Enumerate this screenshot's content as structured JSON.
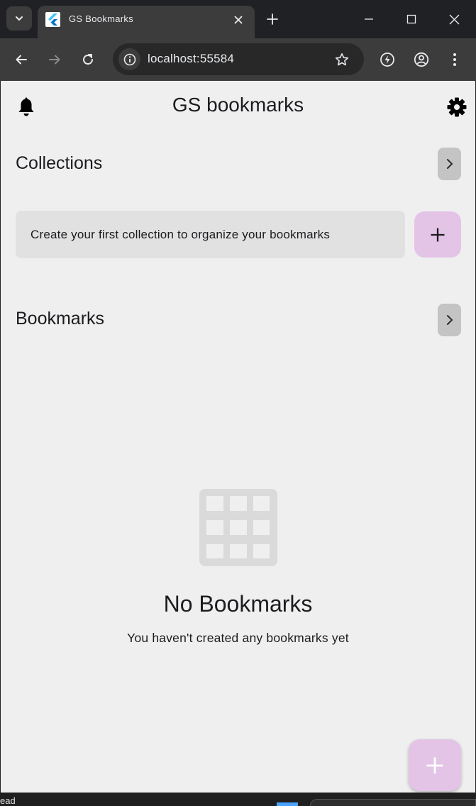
{
  "browser": {
    "tab_title": "GS Bookmarks",
    "url": "localhost:55584",
    "icons": {
      "tab_search": "chevron-down-icon",
      "favicon": "flutter-icon",
      "tab_close": "close-icon",
      "new_tab": "plus-icon",
      "minimize": "minimize-icon",
      "maximize": "maximize-icon",
      "close_window": "close-icon",
      "back": "arrow-left-icon",
      "forward": "arrow-right-icon",
      "reload": "reload-icon",
      "site_info": "info-icon",
      "bookmark_star": "star-icon",
      "performance": "lightning-icon",
      "profile": "profile-icon",
      "menu": "kebab-icon"
    }
  },
  "app": {
    "title": "GS bookmarks",
    "icons": {
      "notifications": "bell-icon",
      "settings": "gear-icon"
    },
    "collections": {
      "heading": "Collections",
      "empty_message": "Create your first collection to organize your bookmarks"
    },
    "bookmarks": {
      "heading": "Bookmarks",
      "empty_title": "No Bookmarks",
      "empty_subtitle": "You haven't created any bookmarks yet"
    }
  },
  "taskbar": {
    "fragment_text": "ead"
  },
  "colors": {
    "accent": "#e3c4e7",
    "background": "#efefef",
    "card": "#e1e1e1",
    "chevron_button": "#c4c4c4",
    "empty_icon": "#dadada"
  }
}
